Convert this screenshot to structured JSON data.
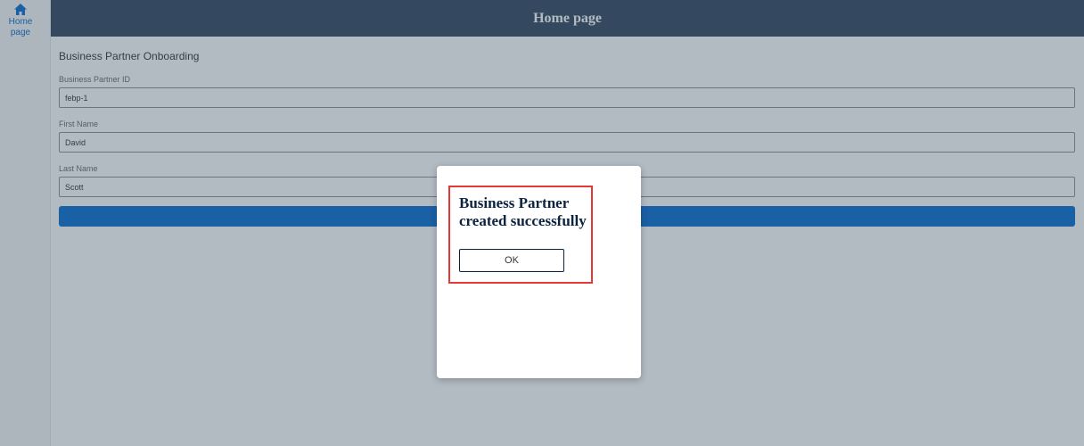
{
  "sidebar": {
    "items": [
      {
        "icon": "home-icon",
        "label": "Home page"
      }
    ]
  },
  "header": {
    "title": "Home page"
  },
  "form": {
    "title": "Business Partner Onboarding",
    "fields": [
      {
        "label": "Business Partner ID",
        "value": "febp-1"
      },
      {
        "label": "First Name",
        "value": "David"
      },
      {
        "label": "Last Name",
        "value": "Scott"
      }
    ],
    "submit_label": ""
  },
  "dialog": {
    "message": "Business Partner created successfully",
    "ok_label": "OK"
  },
  "colors": {
    "header_bg": "#354a5f",
    "accent": "#0a6ed1",
    "highlight": "#e53935"
  }
}
